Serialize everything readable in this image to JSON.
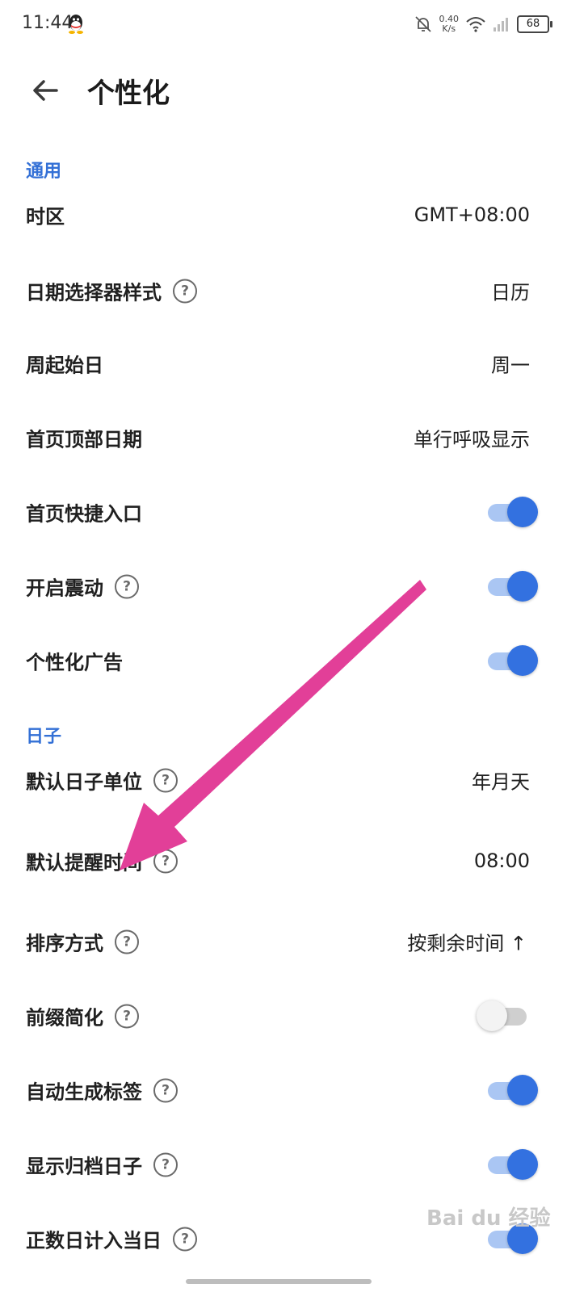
{
  "status_bar": {
    "time": "11:44",
    "net_speed": "0.40",
    "net_unit": "K/s",
    "battery": "68",
    "icons": [
      "qq-icon",
      "bell-off-icon",
      "wifi-icon",
      "signal-icon",
      "battery-icon"
    ]
  },
  "header": {
    "title": "个性化",
    "back_icon": "arrow-left-icon"
  },
  "sections": {
    "general": "通用",
    "days": "日子"
  },
  "rows": {
    "timezone": {
      "label": "时区",
      "value": "GMT+08:00"
    },
    "date_picker": {
      "label": "日期选择器样式",
      "value": "日历"
    },
    "week_start": {
      "label": "周起始日",
      "value": "周一"
    },
    "home_top_date": {
      "label": "首页顶部日期",
      "value": "单行呼吸显示"
    },
    "home_shortcut": {
      "label": "首页快捷入口",
      "toggle": true
    },
    "vibration": {
      "label": "开启震动",
      "toggle": true
    },
    "personal_ads": {
      "label": "个性化广告",
      "toggle": true
    },
    "default_unit": {
      "label": "默认日子单位",
      "value": "年月天"
    },
    "default_reminder": {
      "label": "默认提醒时间",
      "value": "08:00"
    },
    "sort_method": {
      "label": "排序方式",
      "value": "按剩余时间 ↑"
    },
    "prefix_simplify": {
      "label": "前缀简化",
      "toggle": false
    },
    "auto_tags": {
      "label": "自动生成标签",
      "toggle": true
    },
    "show_archived": {
      "label": "显示归档日子",
      "toggle": true
    },
    "count_today": {
      "label": "正数日计入当日",
      "toggle": true
    }
  },
  "help_symbol": "?",
  "watermark": "Bai du 经验",
  "colors": {
    "accent": "#3371e0",
    "section": "#3370d6",
    "annotation_arrow": "#e23f98"
  }
}
